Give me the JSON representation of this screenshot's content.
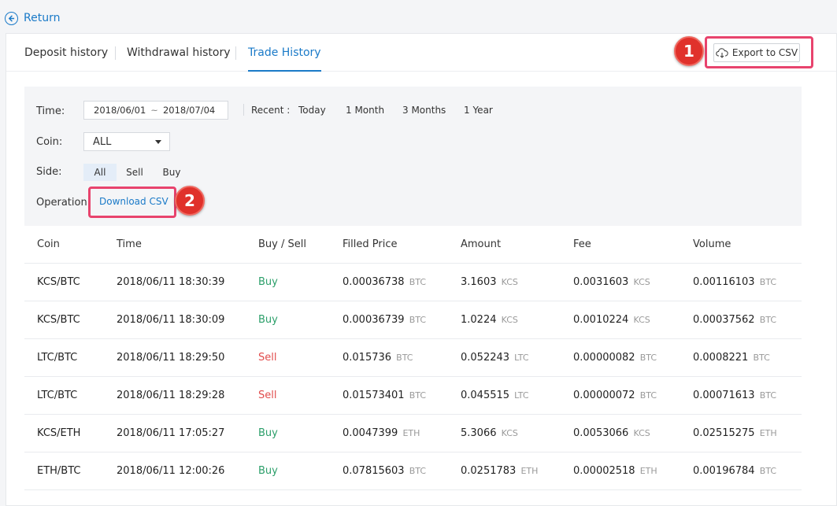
{
  "nav": {
    "return_label": "Return"
  },
  "tabs": [
    {
      "label": "Deposit history"
    },
    {
      "label": "Withdrawal history"
    },
    {
      "label": "Trade History"
    }
  ],
  "export": {
    "label": "Export to CSV"
  },
  "callouts": [
    "1",
    "2"
  ],
  "filters": {
    "time_label": "Time:",
    "date_start": "2018/06/01",
    "date_sep": "~",
    "date_end": "2018/07/04",
    "recent_label": "Recent :",
    "recent": [
      "Today",
      "1 Month",
      "3 Months",
      "1 Year"
    ],
    "coin_label": "Coin:",
    "coin_value": "ALL",
    "side_label": "Side:",
    "side_options": [
      "All",
      "Sell",
      "Buy"
    ],
    "operation_label": "Operation:",
    "download_label": "Download CSV"
  },
  "table": {
    "headers": [
      "Coin",
      "Time",
      "Buy / Sell",
      "Filled Price",
      "Amount",
      "Fee",
      "Volume"
    ],
    "rows": [
      {
        "coin": "KCS/BTC",
        "time": "2018/06/11 18:30:39",
        "side": "Buy",
        "price": "0.00036738",
        "price_unit": "BTC",
        "amount": "3.1603",
        "amount_unit": "KCS",
        "fee": "0.0031603",
        "fee_unit": "KCS",
        "volume": "0.00116103",
        "volume_unit": "BTC"
      },
      {
        "coin": "KCS/BTC",
        "time": "2018/06/11 18:30:09",
        "side": "Buy",
        "price": "0.00036739",
        "price_unit": "BTC",
        "amount": "1.0224",
        "amount_unit": "KCS",
        "fee": "0.0010224",
        "fee_unit": "KCS",
        "volume": "0.00037562",
        "volume_unit": "BTC"
      },
      {
        "coin": "LTC/BTC",
        "time": "2018/06/11 18:29:50",
        "side": "Sell",
        "price": "0.015736",
        "price_unit": "BTC",
        "amount": "0.052243",
        "amount_unit": "LTC",
        "fee": "0.00000082",
        "fee_unit": "BTC",
        "volume": "0.0008221",
        "volume_unit": "BTC"
      },
      {
        "coin": "LTC/BTC",
        "time": "2018/06/11 18:29:28",
        "side": "Sell",
        "price": "0.01573401",
        "price_unit": "BTC",
        "amount": "0.045515",
        "amount_unit": "LTC",
        "fee": "0.00000072",
        "fee_unit": "BTC",
        "volume": "0.00071613",
        "volume_unit": "BTC"
      },
      {
        "coin": "KCS/ETH",
        "time": "2018/06/11 17:05:27",
        "side": "Buy",
        "price": "0.0047399",
        "price_unit": "ETH",
        "amount": "5.3066",
        "amount_unit": "KCS",
        "fee": "0.0053066",
        "fee_unit": "KCS",
        "volume": "0.02515275",
        "volume_unit": "ETH"
      },
      {
        "coin": "ETH/BTC",
        "time": "2018/06/11 12:00:26",
        "side": "Buy",
        "price": "0.07815603",
        "price_unit": "BTC",
        "amount": "0.0251783",
        "amount_unit": "ETH",
        "fee": "0.00002518",
        "fee_unit": "ETH",
        "volume": "0.00196784",
        "volume_unit": "BTC"
      }
    ]
  },
  "colors": {
    "accent": "#1a7ac8",
    "buy": "#2c9f6a",
    "sell": "#e14c4c",
    "highlight": "#e8436d",
    "badge": "#e0312b"
  }
}
